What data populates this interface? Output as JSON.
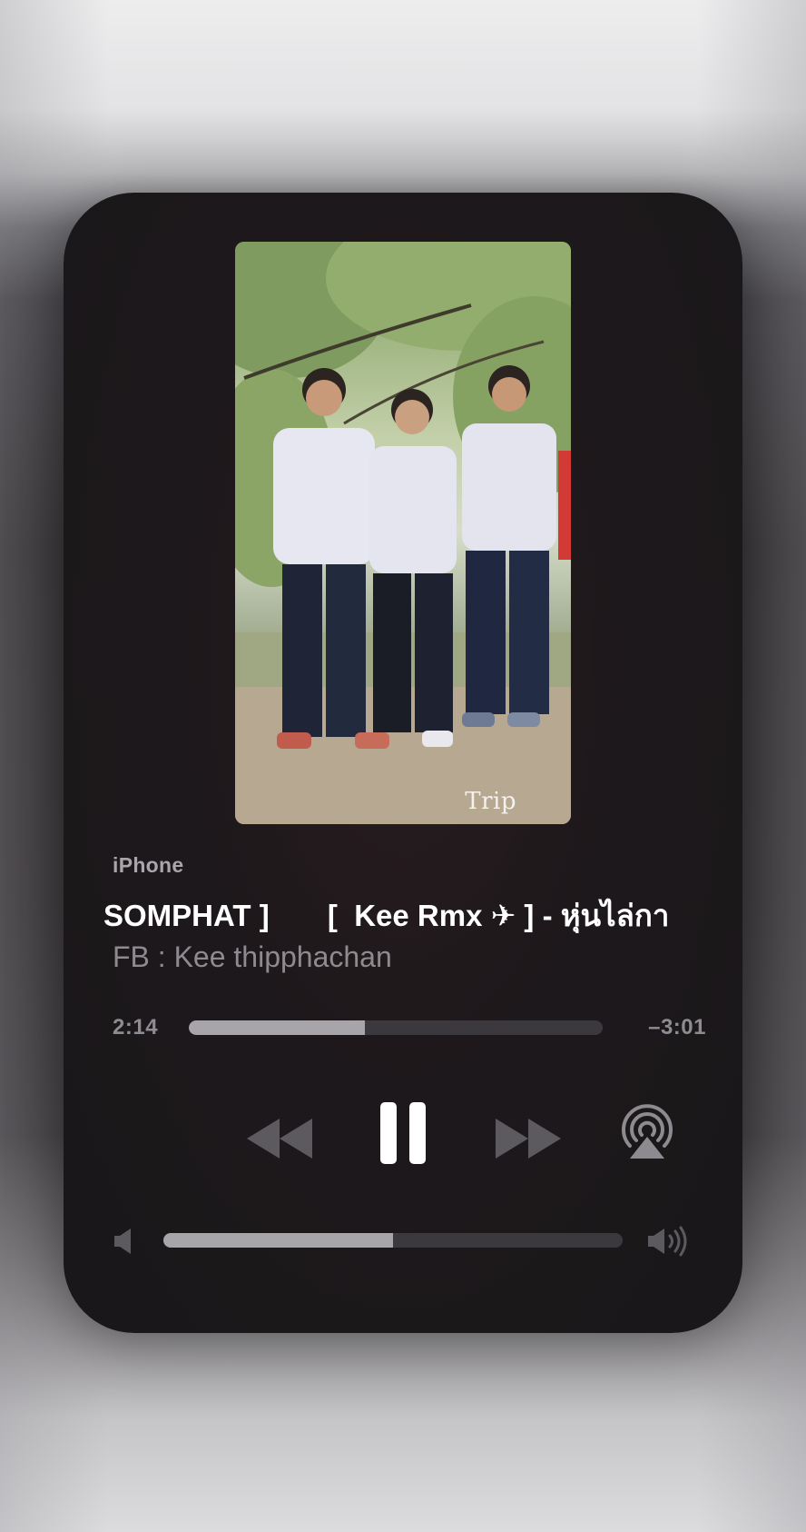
{
  "now_playing": {
    "source": "iPhone",
    "title": "SOMPHAT ]       [  Kee Rmx ✈ ] - หุ่นไล่กา",
    "artist": "FB : Kee thipphachan",
    "artwork_watermark": "Trip"
  },
  "playback": {
    "elapsed": "2:14",
    "remaining": "–3:01",
    "progress_fraction": 0.425,
    "state": "playing"
  },
  "controls": {
    "rewind_icon": "backward-icon",
    "pause_icon": "pause-icon",
    "forward_icon": "forward-icon",
    "airplay_icon": "airplay-icon"
  },
  "volume": {
    "level_fraction": 0.5,
    "min_icon": "speaker-low-icon",
    "max_icon": "speaker-high-icon"
  },
  "colors": {
    "card_background": "#1d181b",
    "primary_text": "#ffffff",
    "secondary_text": "#8d8b90",
    "track": "#3b393d",
    "fill": "#a7a5aa",
    "control_dim": "#5c5a5f"
  }
}
